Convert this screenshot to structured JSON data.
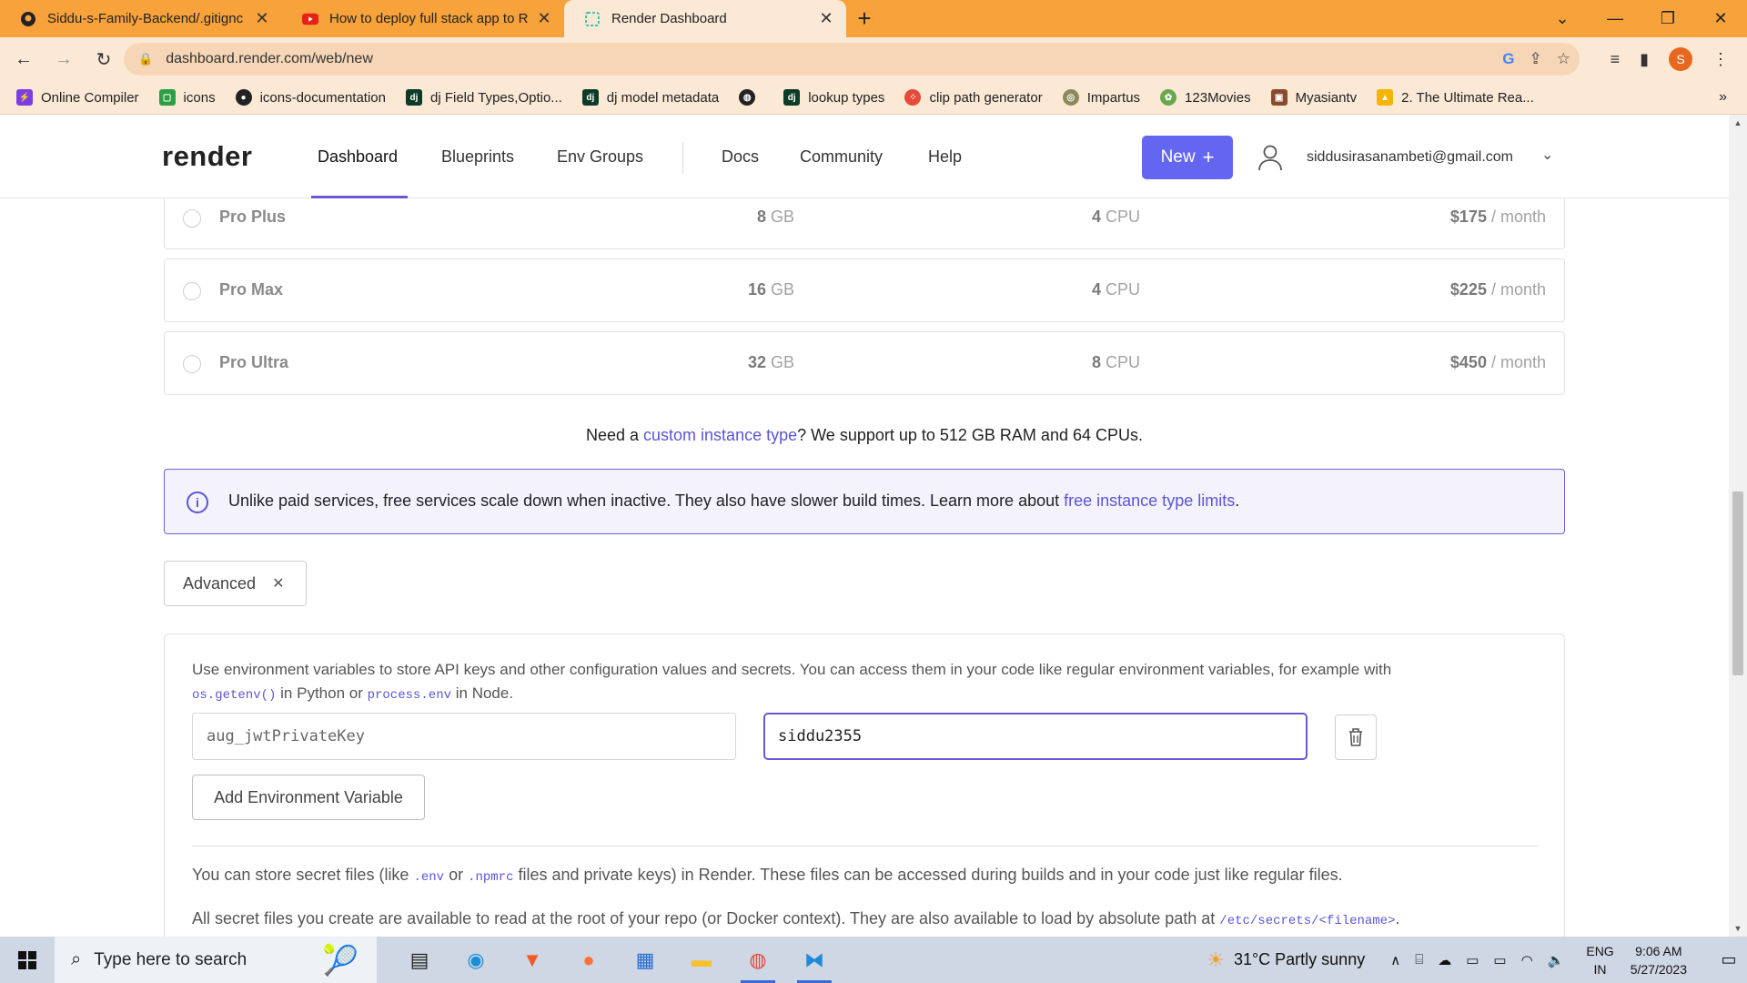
{
  "browser": {
    "tabs": [
      {
        "title": "Siddu-s-Family-Backend/.gitignc",
        "close": "✕",
        "icon": "github-icon",
        "active": false
      },
      {
        "title": "How to deploy full stack app to R",
        "close": "✕",
        "icon": "youtube-icon",
        "active": false
      },
      {
        "title": "Render Dashboard",
        "close": "✕",
        "icon": "render-icon",
        "active": true
      }
    ],
    "new_tab": "+",
    "url": "dashboard.render.com/web/new",
    "profile_initial": "S",
    "bookmarks": [
      {
        "label": "Online Compiler",
        "icon": "bolt-icon",
        "color": "#7b3fe4"
      },
      {
        "label": "icons",
        "icon": "square-icon",
        "color": "#2e9e44"
      },
      {
        "label": "icons-documentation",
        "icon": "github-icon",
        "color": "#222222"
      },
      {
        "label": "dj Field Types,Optio...",
        "icon": "django-icon",
        "color": "#0c3c26"
      },
      {
        "label": "dj model metadata",
        "icon": "django-icon",
        "color": "#0c3c26"
      },
      {
        "label": "",
        "icon": "globe-icon",
        "color": "#222222"
      },
      {
        "label": "lookup types",
        "icon": "django-icon",
        "color": "#0c3c26"
      },
      {
        "label": "clip path generator",
        "icon": "dots-icon",
        "color": "#e64a3b"
      },
      {
        "label": "Impartus",
        "icon": "circle-icon",
        "color": "#8a8a5a"
      },
      {
        "label": "123Movies",
        "icon": "film-icon",
        "color": "#6aa84f"
      },
      {
        "label": "Myasiantv",
        "icon": "tv-icon",
        "color": "#8b4a2b"
      },
      {
        "label": "2. The Ultimate Rea...",
        "icon": "drive-icon",
        "color": "#f4b400"
      }
    ],
    "bookmarks_more": "»"
  },
  "nav": {
    "logo": "render",
    "links": [
      "Dashboard",
      "Blueprints",
      "Env Groups",
      "Docs",
      "Community",
      "Help"
    ],
    "active": "Dashboard",
    "new_button": "New",
    "new_icon": "+",
    "user_email": "siddusirasanambeti@gmail.com",
    "accent": "#6366f1"
  },
  "plans": [
    {
      "name": "Pro Plus",
      "ram": "8",
      "ram_unit": "GB",
      "cpu": "4",
      "cpu_unit": "CPU",
      "price": "$175",
      "price_unit": "/ month"
    },
    {
      "name": "Pro Max",
      "ram": "16",
      "ram_unit": "GB",
      "cpu": "4",
      "cpu_unit": "CPU",
      "price": "$225",
      "price_unit": "/ month"
    },
    {
      "name": "Pro Ultra",
      "ram": "32",
      "ram_unit": "GB",
      "cpu": "8",
      "cpu_unit": "CPU",
      "price": "$450",
      "price_unit": "/ month"
    }
  ],
  "custom": {
    "prefix": "Need a ",
    "link": "custom instance type",
    "suffix": "? We support up to 512 GB RAM and 64 CPUs."
  },
  "info": {
    "text": "Unlike paid services, free services scale down when inactive. They also have slower build times. Learn more about ",
    "link": "free instance type limits",
    "end": "."
  },
  "advanced": {
    "label": "Advanced",
    "close": "✕"
  },
  "env": {
    "desc": "Use environment variables to store API keys and other configuration values and secrets. You can access them in your code like regular environment variables, for example with",
    "code1": "os.getenv()",
    "mid": " in Python or ",
    "code2": "process.env",
    "end": " in Node.",
    "key_value": "aug_jwtPrivateKey",
    "value_value": "siddu2355",
    "add_label": "Add Environment Variable"
  },
  "secrets": {
    "line1_a": "You can store secret files (like ",
    "code_env": ".env",
    "line1_b": " or ",
    "code_npmrc": ".npmrc",
    "line1_c": " files and private keys) in Render. These files can be accessed during builds and in your code just like regular files.",
    "line2_a": "All secret files you create are available to read at the root of your repo (or Docker context). They are also available to load by absolute path at ",
    "code_path": "/etc/secrets/<filename>",
    "line2_b": "."
  },
  "taskbar": {
    "search_placeholder": "Type here to search",
    "weather": "31°C  Partly sunny",
    "lang_1": "ENG",
    "lang_2": "IN",
    "time": "9:06 AM",
    "date": "5/27/2023"
  }
}
